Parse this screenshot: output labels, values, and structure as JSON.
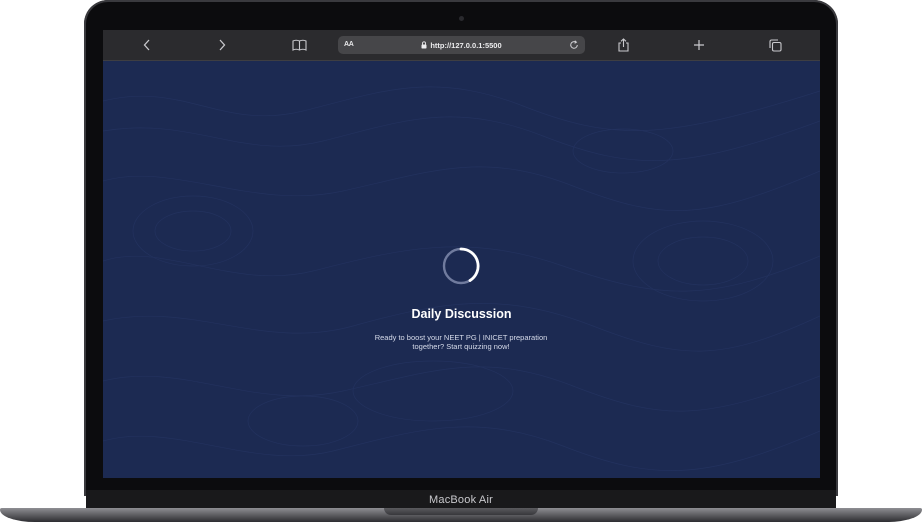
{
  "device": {
    "label": "MacBook Air"
  },
  "browser": {
    "text_size_label": "AA",
    "url": "http://127.0.0.1:5500",
    "icons": [
      "back-icon",
      "forward-icon",
      "reader-book-icon",
      "lock-icon",
      "reload-icon",
      "share-icon",
      "new-tab-icon",
      "tabs-overview-icon"
    ]
  },
  "page": {
    "title": "Daily Discussion",
    "subtitle": "Ready to boost your NEET PG | INICET preparation together? Start quizzing now!",
    "background_color": "#1c2a52",
    "loader": "loading-spinner"
  }
}
